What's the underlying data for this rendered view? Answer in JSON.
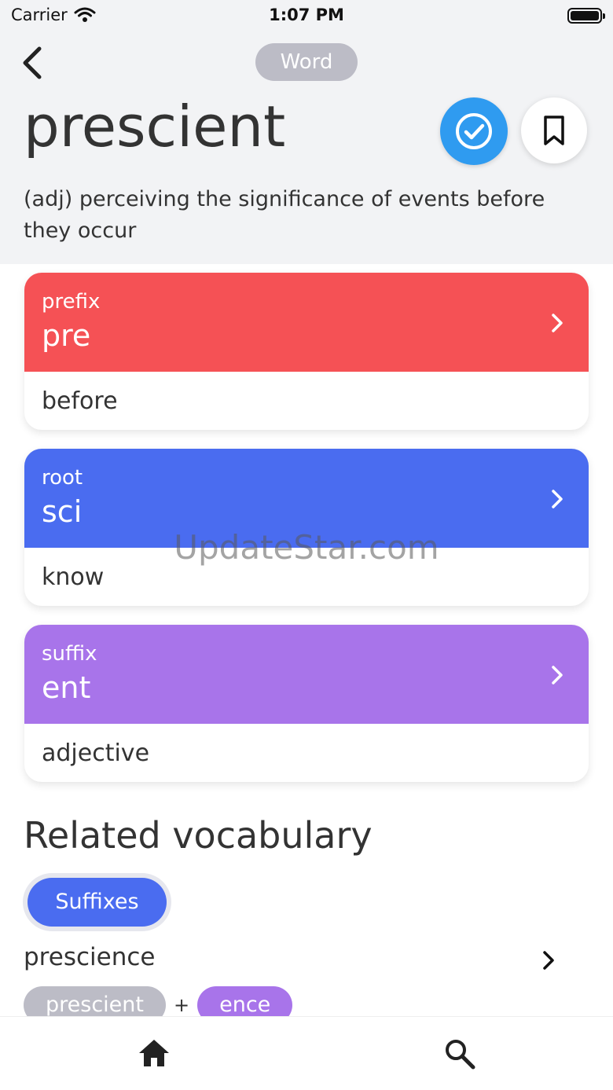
{
  "status_bar": {
    "carrier": "Carrier",
    "time": "1:07 PM"
  },
  "header": {
    "badge": "Word",
    "word": "prescient",
    "definition": "(adj) perceiving the significance of events before they occur"
  },
  "cards": [
    {
      "kind": "prefix",
      "part": "pre",
      "meaning": "before",
      "color": "#f55155"
    },
    {
      "kind": "root",
      "part": "sci",
      "meaning": "know",
      "color": "#4a6cf0"
    },
    {
      "kind": "suffix",
      "part": "ent",
      "meaning": "adjective",
      "color": "#a874ea"
    }
  ],
  "watermark": "UpdateStar.com",
  "related": {
    "title": "Related vocabulary",
    "filter": "Suffixes",
    "items": [
      {
        "word": "prescience",
        "parts": [
          "prescient",
          "ence"
        ],
        "joiner": "+"
      }
    ]
  },
  "colors": {
    "header_bg": "#f2f3f5",
    "check_blue": "#2f9bf0",
    "badge_gray": "#bcbcc6"
  },
  "icons": {
    "back": "chevron-left-icon",
    "check": "check-circle-icon",
    "bookmark": "bookmark-icon",
    "home": "home-icon",
    "search": "search-icon"
  }
}
